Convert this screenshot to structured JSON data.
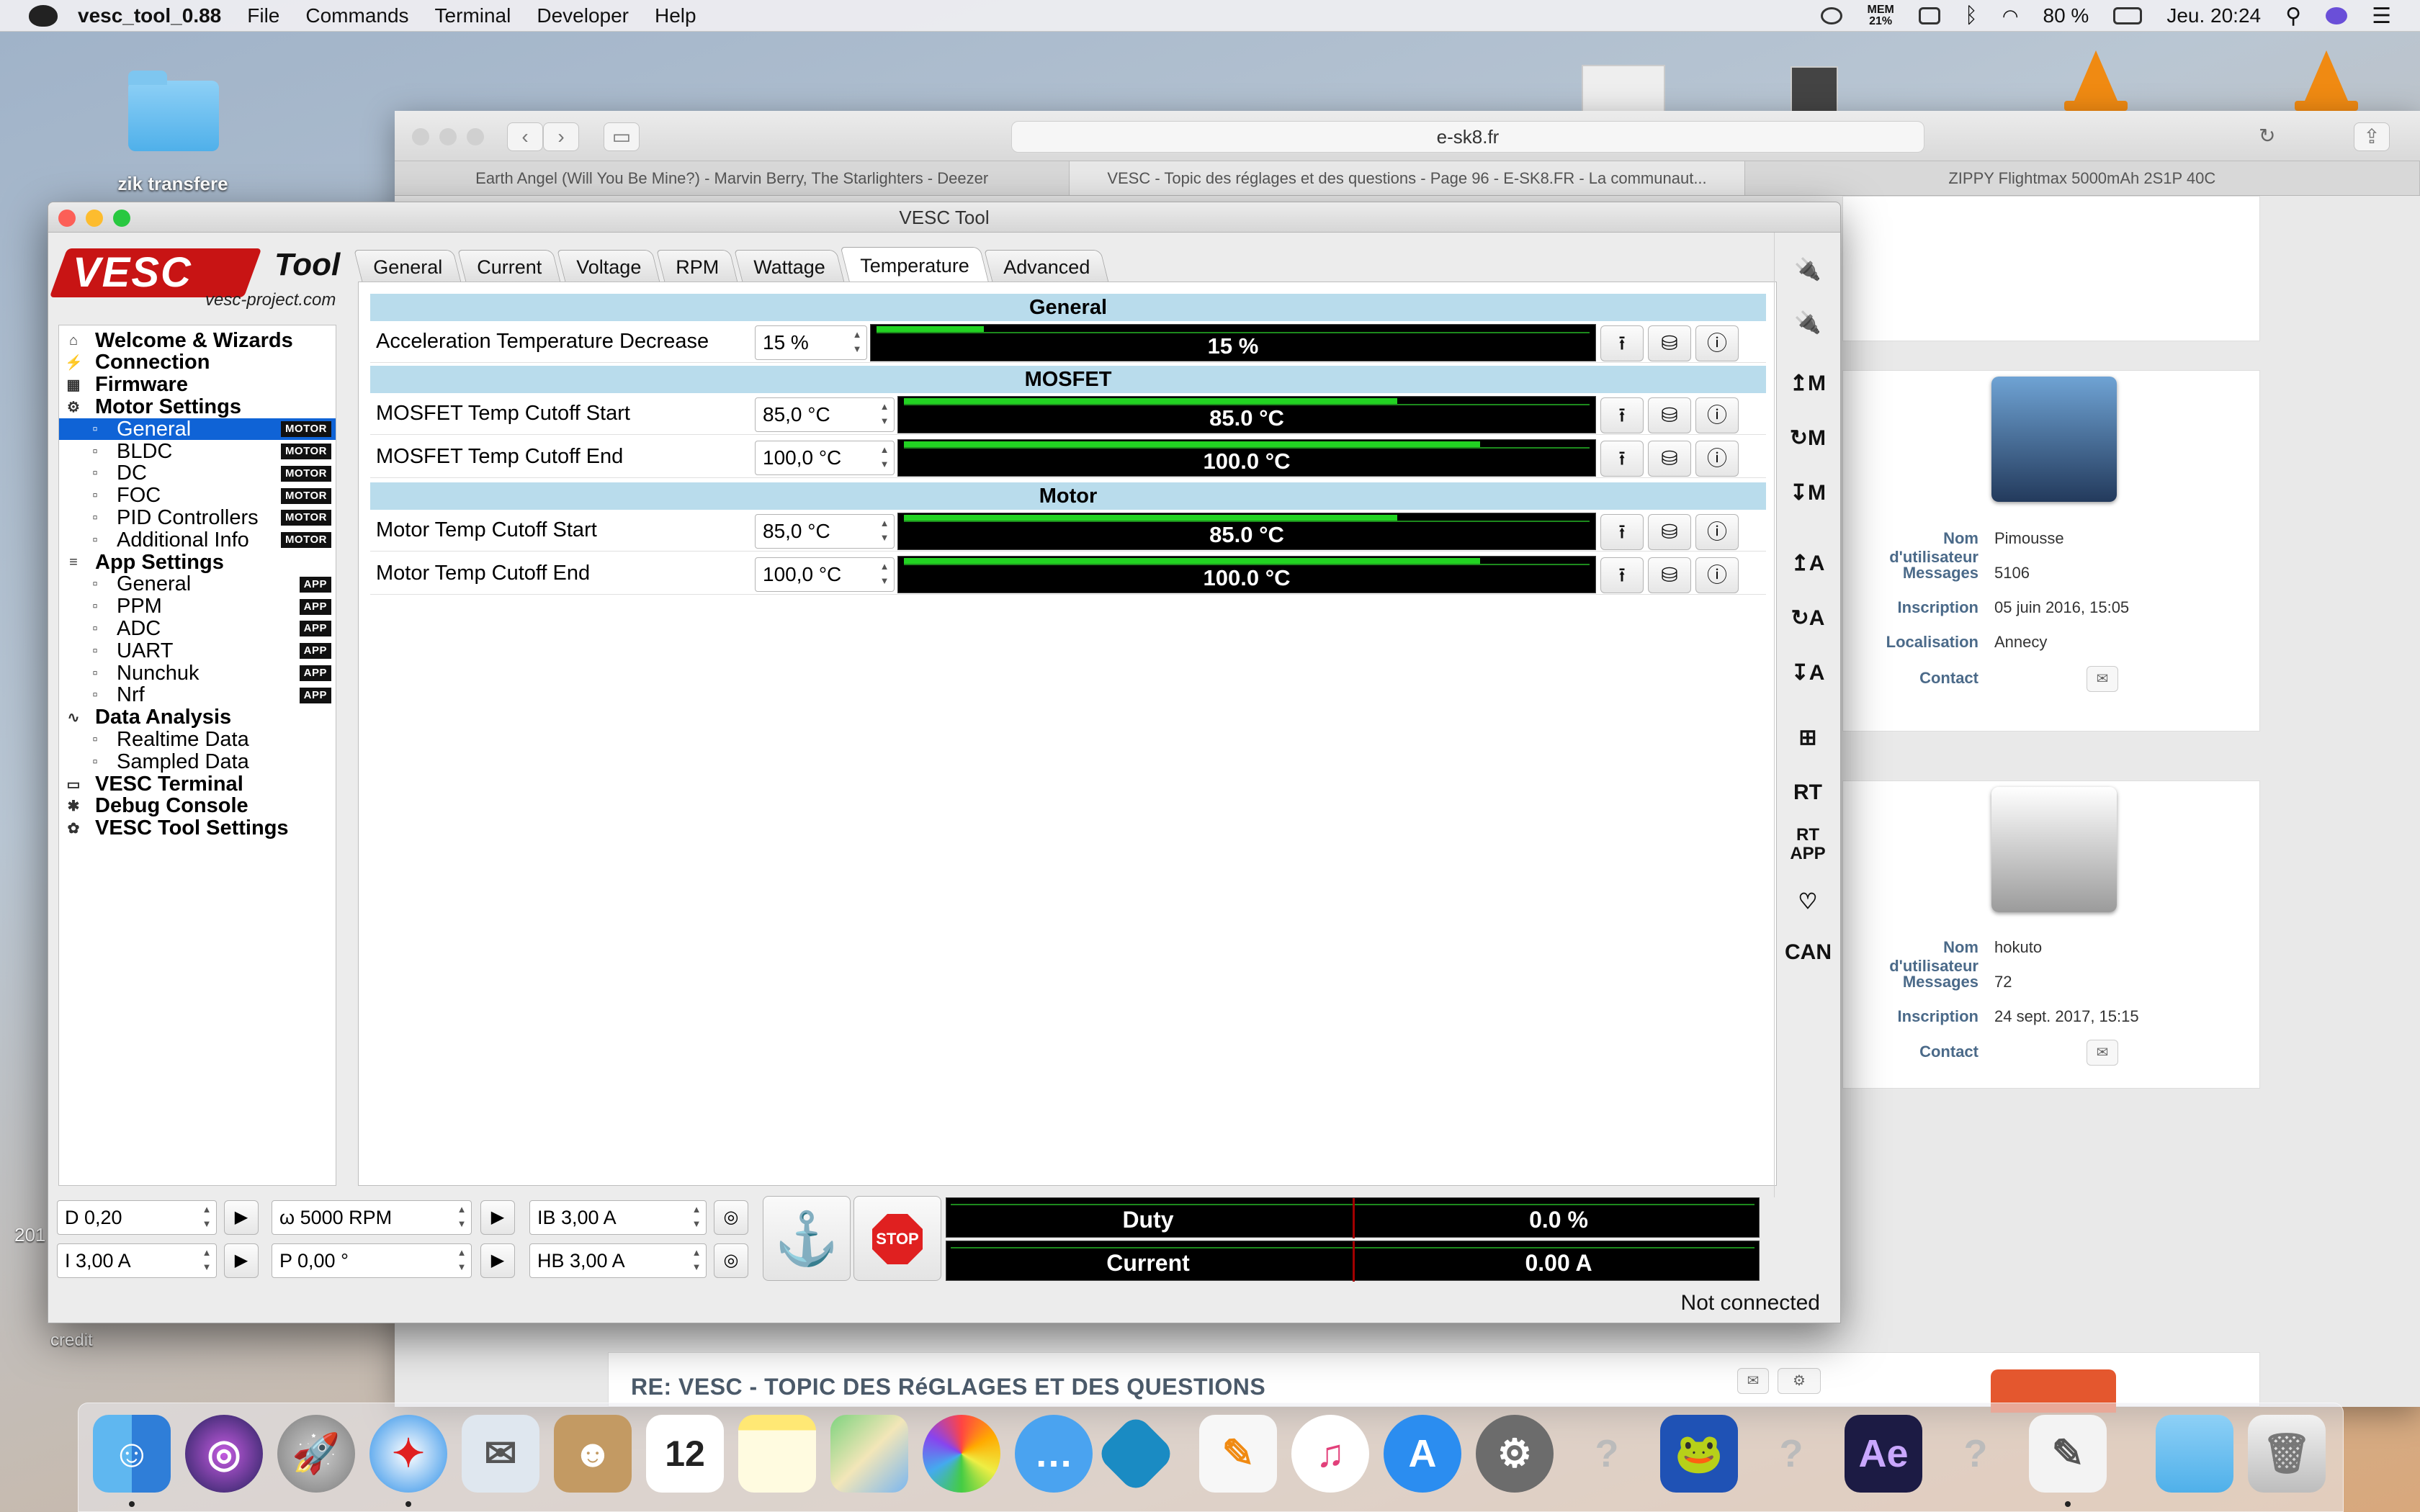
{
  "menubar": {
    "app_name": "vesc_tool_0.88",
    "items": [
      "File",
      "Commands",
      "Terminal",
      "Developer",
      "Help"
    ],
    "mem_label": "MEM",
    "mem_value": "21%",
    "battery": "80 %",
    "clock": "Jeu. 20:24"
  },
  "desktop": {
    "folder_label": "zik transfere",
    "side_year": "201",
    "credit": "credit"
  },
  "safari": {
    "url": "e-sk8.fr",
    "tabs": [
      "Earth Angel (Will You Be Mine?) - Marvin Berry, The Starlighters - Deezer",
      "VESC - Topic des réglages et des questions - Page 96 - E-SK8.FR - La communaut...",
      "ZIPPY Flightmax 5000mAh 2S1P 40C"
    ],
    "profiles": [
      {
        "nom_label": "Nom d'utilisateur",
        "nom": "Pimousse",
        "messages_label": "Messages",
        "messages": "5106",
        "inscription_label": "Inscription",
        "inscription": "05 juin 2016, 15:05",
        "localisation_label": "Localisation",
        "localisation": "Annecy",
        "contact_label": "Contact"
      },
      {
        "nom_label": "Nom d'utilisateur",
        "nom": "hokuto",
        "messages_label": "Messages",
        "messages": "72",
        "inscription_label": "Inscription",
        "inscription": "24 sept. 2017, 15:15",
        "contact_label": "Contact"
      }
    ],
    "post_title": "RE: VESC - TOPIC DES RéGLAGES ET DES QUESTIONS"
  },
  "vesc": {
    "window_title": "VESC Tool",
    "logo_text": "VESC",
    "logo_tool": "Tool",
    "logo_url": "vesc-project.com",
    "tree": [
      {
        "label": "Welcome & Wizards",
        "level": 0,
        "icon": "home-icon"
      },
      {
        "label": "Connection",
        "level": 0,
        "icon": "plug-icon"
      },
      {
        "label": "Firmware",
        "level": 0,
        "icon": "chip-icon"
      },
      {
        "label": "Motor Settings",
        "level": 0,
        "icon": "motor-icon"
      },
      {
        "label": "General",
        "level": 1,
        "badge": "MOTOR",
        "selected": true
      },
      {
        "label": "BLDC",
        "level": 1,
        "badge": "MOTOR"
      },
      {
        "label": "DC",
        "level": 1,
        "badge": "MOTOR"
      },
      {
        "label": "FOC",
        "level": 1,
        "badge": "MOTOR"
      },
      {
        "label": "PID Controllers",
        "level": 1,
        "badge": "MOTOR"
      },
      {
        "label": "Additional Info",
        "level": 1,
        "badge": "MOTOR"
      },
      {
        "label": "App Settings",
        "level": 0,
        "icon": "sliders-icon"
      },
      {
        "label": "General",
        "level": 1,
        "badge": "APP"
      },
      {
        "label": "PPM",
        "level": 1,
        "badge": "APP"
      },
      {
        "label": "ADC",
        "level": 1,
        "badge": "APP"
      },
      {
        "label": "UART",
        "level": 1,
        "badge": "APP"
      },
      {
        "label": "Nunchuk",
        "level": 1,
        "badge": "APP"
      },
      {
        "label": "Nrf",
        "level": 1,
        "badge": "APP"
      },
      {
        "label": "Data Analysis",
        "level": 0,
        "icon": "wave-icon"
      },
      {
        "label": "Realtime Data",
        "level": 1
      },
      {
        "label": "Sampled Data",
        "level": 1
      },
      {
        "label": "VESC Terminal",
        "level": 0,
        "icon": "terminal-icon"
      },
      {
        "label": "Debug Console",
        "level": 0,
        "icon": "bug-icon"
      },
      {
        "label": "VESC Tool Settings",
        "level": 0,
        "icon": "gear-icon"
      }
    ],
    "tabs": [
      "General",
      "Current",
      "Voltage",
      "RPM",
      "Wattage",
      "Temperature",
      "Advanced"
    ],
    "active_tab": "Temperature",
    "sections": {
      "general": "General",
      "mosfet": "MOSFET",
      "motor": "Motor"
    },
    "params": {
      "accel_temp_decrease": {
        "label": "Acceleration Temperature Decrease",
        "value": "15 %",
        "bar_text": "15 %",
        "fraction": 0.15
      },
      "mosfet_start": {
        "label": "MOSFET Temp Cutoff Start",
        "value": "85,0 °C",
        "bar_text": "85.0 °C",
        "fraction": 0.72
      },
      "mosfet_end": {
        "label": "MOSFET Temp Cutoff End",
        "value": "100,0 °C",
        "bar_text": "100.0 °C",
        "fraction": 0.84
      },
      "motor_start": {
        "label": "Motor Temp Cutoff Start",
        "value": "85,0 °C",
        "bar_text": "85.0 °C",
        "fraction": 0.72
      },
      "motor_end": {
        "label": "Motor Temp Cutoff End",
        "value": "100,0 °C",
        "bar_text": "100.0 °C",
        "fraction": 0.84
      }
    },
    "right_toolbar": [
      "↥M",
      "↻M",
      "↧M",
      "↥A",
      "↻A",
      "↧A",
      "RT",
      "RT APP",
      "CAN"
    ],
    "controls": {
      "duty": "D 0,20",
      "current": "I 3,00 A",
      "rpm": "ω 5000 RPM",
      "position": "P 0,00 °",
      "brake": "IB 3,00 A",
      "handbrake": "HB 3,00 A",
      "stop_label": "STOP"
    },
    "realtime": [
      {
        "name": "Duty",
        "value": "0.0 %"
      },
      {
        "name": "Current",
        "value": "0.00 A"
      }
    ],
    "status": "Not connected"
  },
  "colors": {
    "accent_blue": "#0f63d6",
    "section_blue": "#b9dcec",
    "bar_green": "#22d322",
    "stop_red": "#e02020"
  }
}
